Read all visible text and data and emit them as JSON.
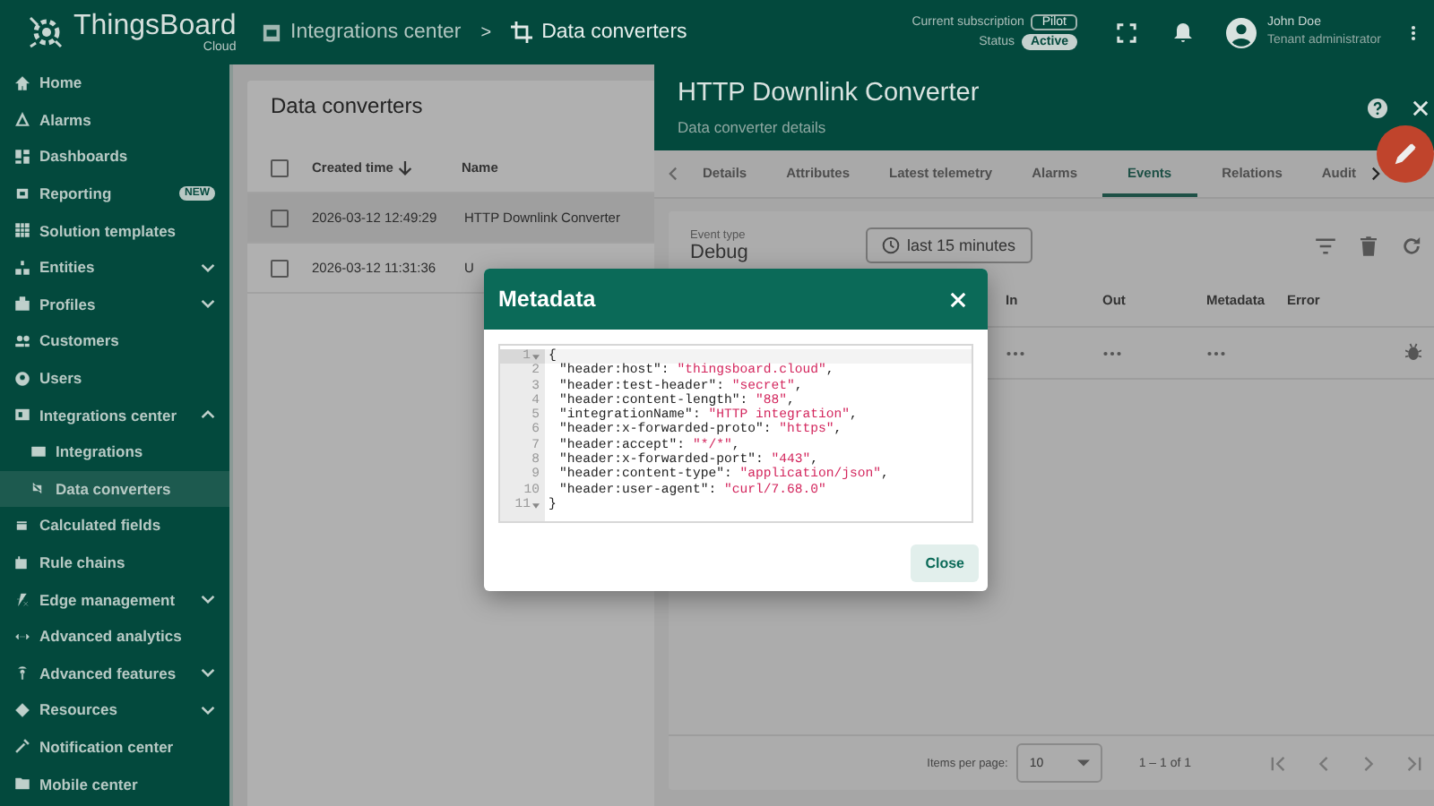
{
  "app": {
    "name": "ThingsBoard",
    "edition": "Cloud"
  },
  "breadcrumbs": {
    "items": [
      {
        "label": "Integrations center"
      },
      {
        "label": "Data converters"
      }
    ],
    "separator": ">"
  },
  "subscription": {
    "label": "Current subscription",
    "plan": "Pilot",
    "status_label": "Status",
    "status": "Active"
  },
  "user": {
    "name": "John Doe",
    "role": "Tenant administrator"
  },
  "sidebar": {
    "items": [
      {
        "label": "Home",
        "kind": "link",
        "selected": false
      },
      {
        "label": "Alarms",
        "kind": "link",
        "selected": false
      },
      {
        "label": "Dashboards",
        "kind": "link",
        "selected": false
      },
      {
        "label": "Reporting",
        "kind": "link",
        "selected": false,
        "badge": "NEW"
      },
      {
        "label": "Solution templates",
        "kind": "link",
        "selected": false
      },
      {
        "label": "Entities",
        "kind": "group",
        "expanded": false,
        "selected": false
      },
      {
        "label": "Profiles",
        "kind": "group",
        "expanded": false,
        "selected": false
      },
      {
        "label": "Customers",
        "kind": "link",
        "selected": false
      },
      {
        "label": "Users",
        "kind": "link",
        "selected": false
      },
      {
        "label": "Integrations center",
        "kind": "group",
        "expanded": true,
        "selected": false,
        "children": [
          {
            "label": "Integrations",
            "selected": false
          },
          {
            "label": "Data converters",
            "selected": true
          }
        ]
      },
      {
        "label": "Calculated fields",
        "kind": "link",
        "selected": false
      },
      {
        "label": "Rule chains",
        "kind": "link",
        "selected": false
      },
      {
        "label": "Edge management",
        "kind": "group",
        "expanded": false,
        "selected": false
      },
      {
        "label": "Advanced analytics",
        "kind": "link",
        "selected": false
      },
      {
        "label": "Advanced features",
        "kind": "group",
        "expanded": false,
        "selected": false
      },
      {
        "label": "Resources",
        "kind": "group",
        "expanded": false,
        "selected": false
      },
      {
        "label": "Notification center",
        "kind": "link",
        "selected": false
      },
      {
        "label": "Mobile center",
        "kind": "link",
        "selected": false
      }
    ]
  },
  "converters": {
    "title": "Data converters",
    "all_checked": false,
    "columns": [
      "Created time",
      "Name"
    ],
    "rows": [
      {
        "created": "2026-03-12 12:49:29",
        "name": "HTTP Downlink Converter",
        "selected": true,
        "checked": false
      },
      {
        "created": "2026-03-12 11:31:36",
        "name": "U",
        "selected": false,
        "checked": false
      }
    ]
  },
  "details": {
    "title": "HTTP Downlink Converter",
    "subtitle": "Data converter details",
    "tabs": [
      {
        "label": "Details",
        "selected": false
      },
      {
        "label": "Attributes",
        "selected": false
      },
      {
        "label": "Latest telemetry",
        "selected": false
      },
      {
        "label": "Alarms",
        "selected": false
      },
      {
        "label": "Events",
        "selected": true
      },
      {
        "label": "Relations",
        "selected": false
      },
      {
        "label": "Audit",
        "selected": false
      }
    ],
    "event_type": {
      "label": "Event type",
      "value": "Debug"
    },
    "time_button": "last 15 minutes",
    "columns": [
      "In",
      "Out",
      "Metadata",
      "Error"
    ],
    "paginator": {
      "label": "Items per page:",
      "page_size": "10",
      "range": "1 – 1 of 1"
    }
  },
  "dialog": {
    "title": "Metadata",
    "line_numbers": [
      "1",
      "2",
      "3",
      "4",
      "5",
      "6",
      "7",
      "8",
      "9",
      "10",
      "11"
    ],
    "open": "{",
    "close": "}",
    "entries": [
      {
        "key": "\"header:host\": ",
        "value": "\"thingsboard.cloud\"",
        "trail": ","
      },
      {
        "key": "\"header:test-header\": ",
        "value": "\"secret\"",
        "trail": ","
      },
      {
        "key": "\"header:content-length\": ",
        "value": "\"88\"",
        "trail": ","
      },
      {
        "key": "\"integrationName\": ",
        "value": "\"HTTP integration\"",
        "trail": ","
      },
      {
        "key": "\"header:x-forwarded-proto\": ",
        "value": "\"https\"",
        "trail": ","
      },
      {
        "key": "\"header:accept\": ",
        "value": "\"*/*\"",
        "trail": ","
      },
      {
        "key": "\"header:x-forwarded-port\": ",
        "value": "\"443\"",
        "trail": ","
      },
      {
        "key": "\"header:content-type\": ",
        "value": "\"application/json\"",
        "trail": ","
      },
      {
        "key": "\"header:user-agent\": ",
        "value": "\"curl/7.68.0\""
      }
    ],
    "button": "Close"
  }
}
